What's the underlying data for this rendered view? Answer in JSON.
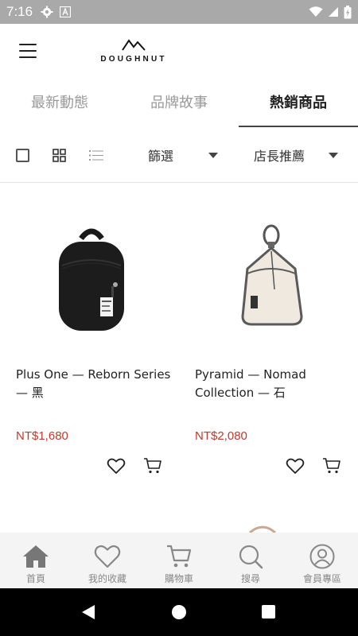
{
  "status_bar": {
    "time": "7:16"
  },
  "header": {
    "brand": "DOUGHNUT"
  },
  "tabs": [
    {
      "label": "最新動態"
    },
    {
      "label": "品牌故事"
    },
    {
      "label": "熱銷商品"
    }
  ],
  "toolbar": {
    "filter_label": "篩選",
    "sort_label": "店長推薦"
  },
  "products": [
    {
      "name": "Plus One — Reborn Series — 黑",
      "price": "NT$1,680"
    },
    {
      "name": "Pyramid — Nomad Collection — 石",
      "price": "NT$2,080"
    }
  ],
  "bottom_nav": [
    {
      "label": "首頁"
    },
    {
      "label": "我的收藏"
    },
    {
      "label": "購物車"
    },
    {
      "label": "搜尋"
    },
    {
      "label": "會員專區"
    }
  ],
  "colors": {
    "price": "#c0392b",
    "status_bar": "#a9a9a9",
    "nav_bg": "#f4f4f4",
    "active_tab": "#222222"
  }
}
